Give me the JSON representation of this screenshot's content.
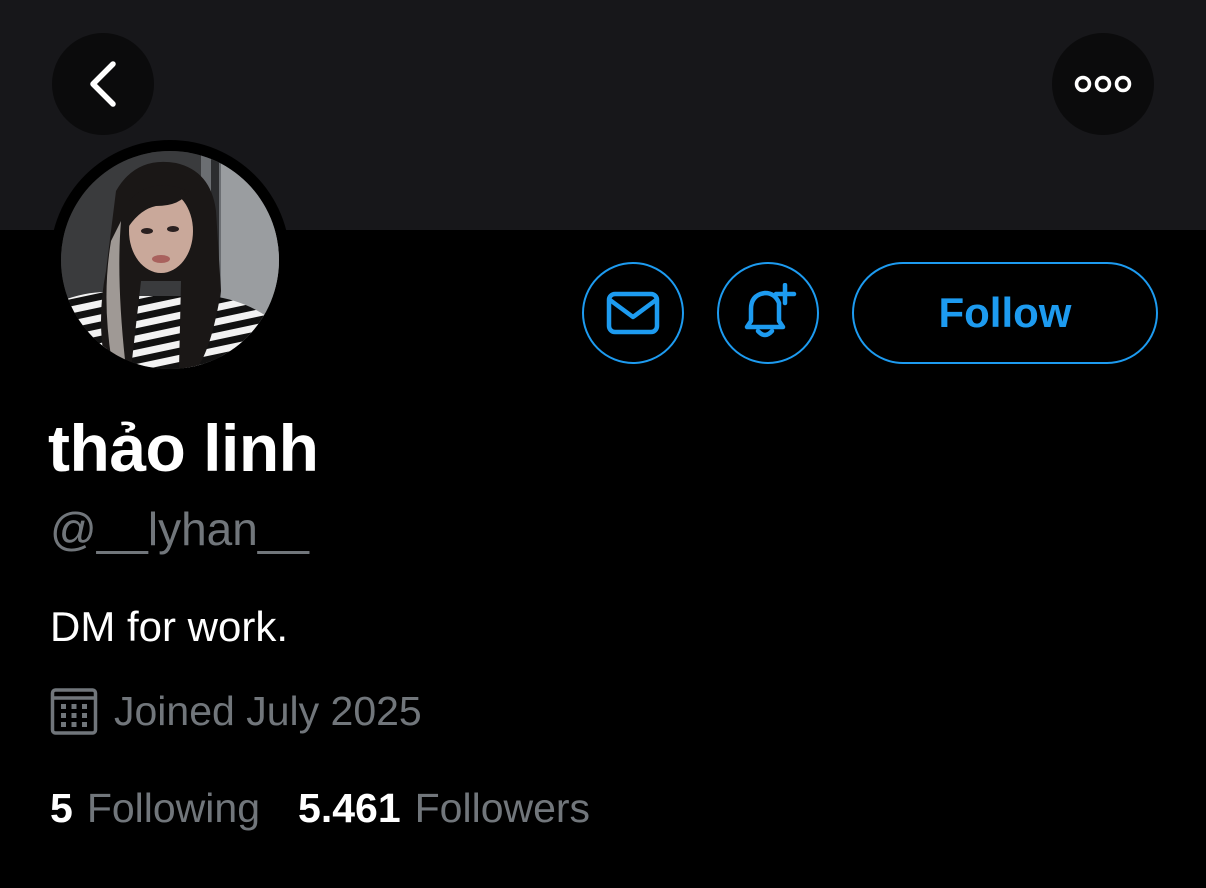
{
  "header": {
    "back_icon": "chevron-left-icon",
    "more_icon": "more-horizontal-icon"
  },
  "profile": {
    "display_name": "thảo linh",
    "handle": "@__lyhan__",
    "bio": "DM for work.",
    "joined": "Joined July 2025",
    "joined_icon": "calendar-icon",
    "avatar_alt": "profile photo"
  },
  "actions": {
    "message_icon": "mail-icon",
    "notify_icon": "bell-plus-icon",
    "follow_label": "Follow"
  },
  "stats": {
    "following_count": "5",
    "following_label": "Following",
    "followers_count": "5.461",
    "followers_label": "Followers"
  },
  "colors": {
    "accent": "#1d9bf0",
    "background": "#000000",
    "banner": "#17171a",
    "secondary_text": "#71767b"
  }
}
